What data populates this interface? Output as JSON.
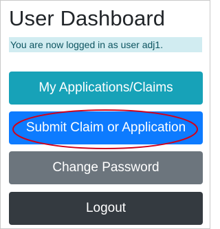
{
  "page": {
    "title": "User Dashboard",
    "login_notice": "You are now logged in as user adj1."
  },
  "actions": {
    "my_applications": "My Applications/Claims",
    "submit_claim": "Submit Claim or Application",
    "change_password": "Change Password",
    "logout": "Logout"
  },
  "colors": {
    "info": "#17a2b8",
    "primary": "#0d7bff",
    "secondary": "#6c757d",
    "dark": "#343a40",
    "alert_bg": "#d1ecf1",
    "alert_text": "#0c5460",
    "highlight_ellipse": "#d0021b"
  }
}
